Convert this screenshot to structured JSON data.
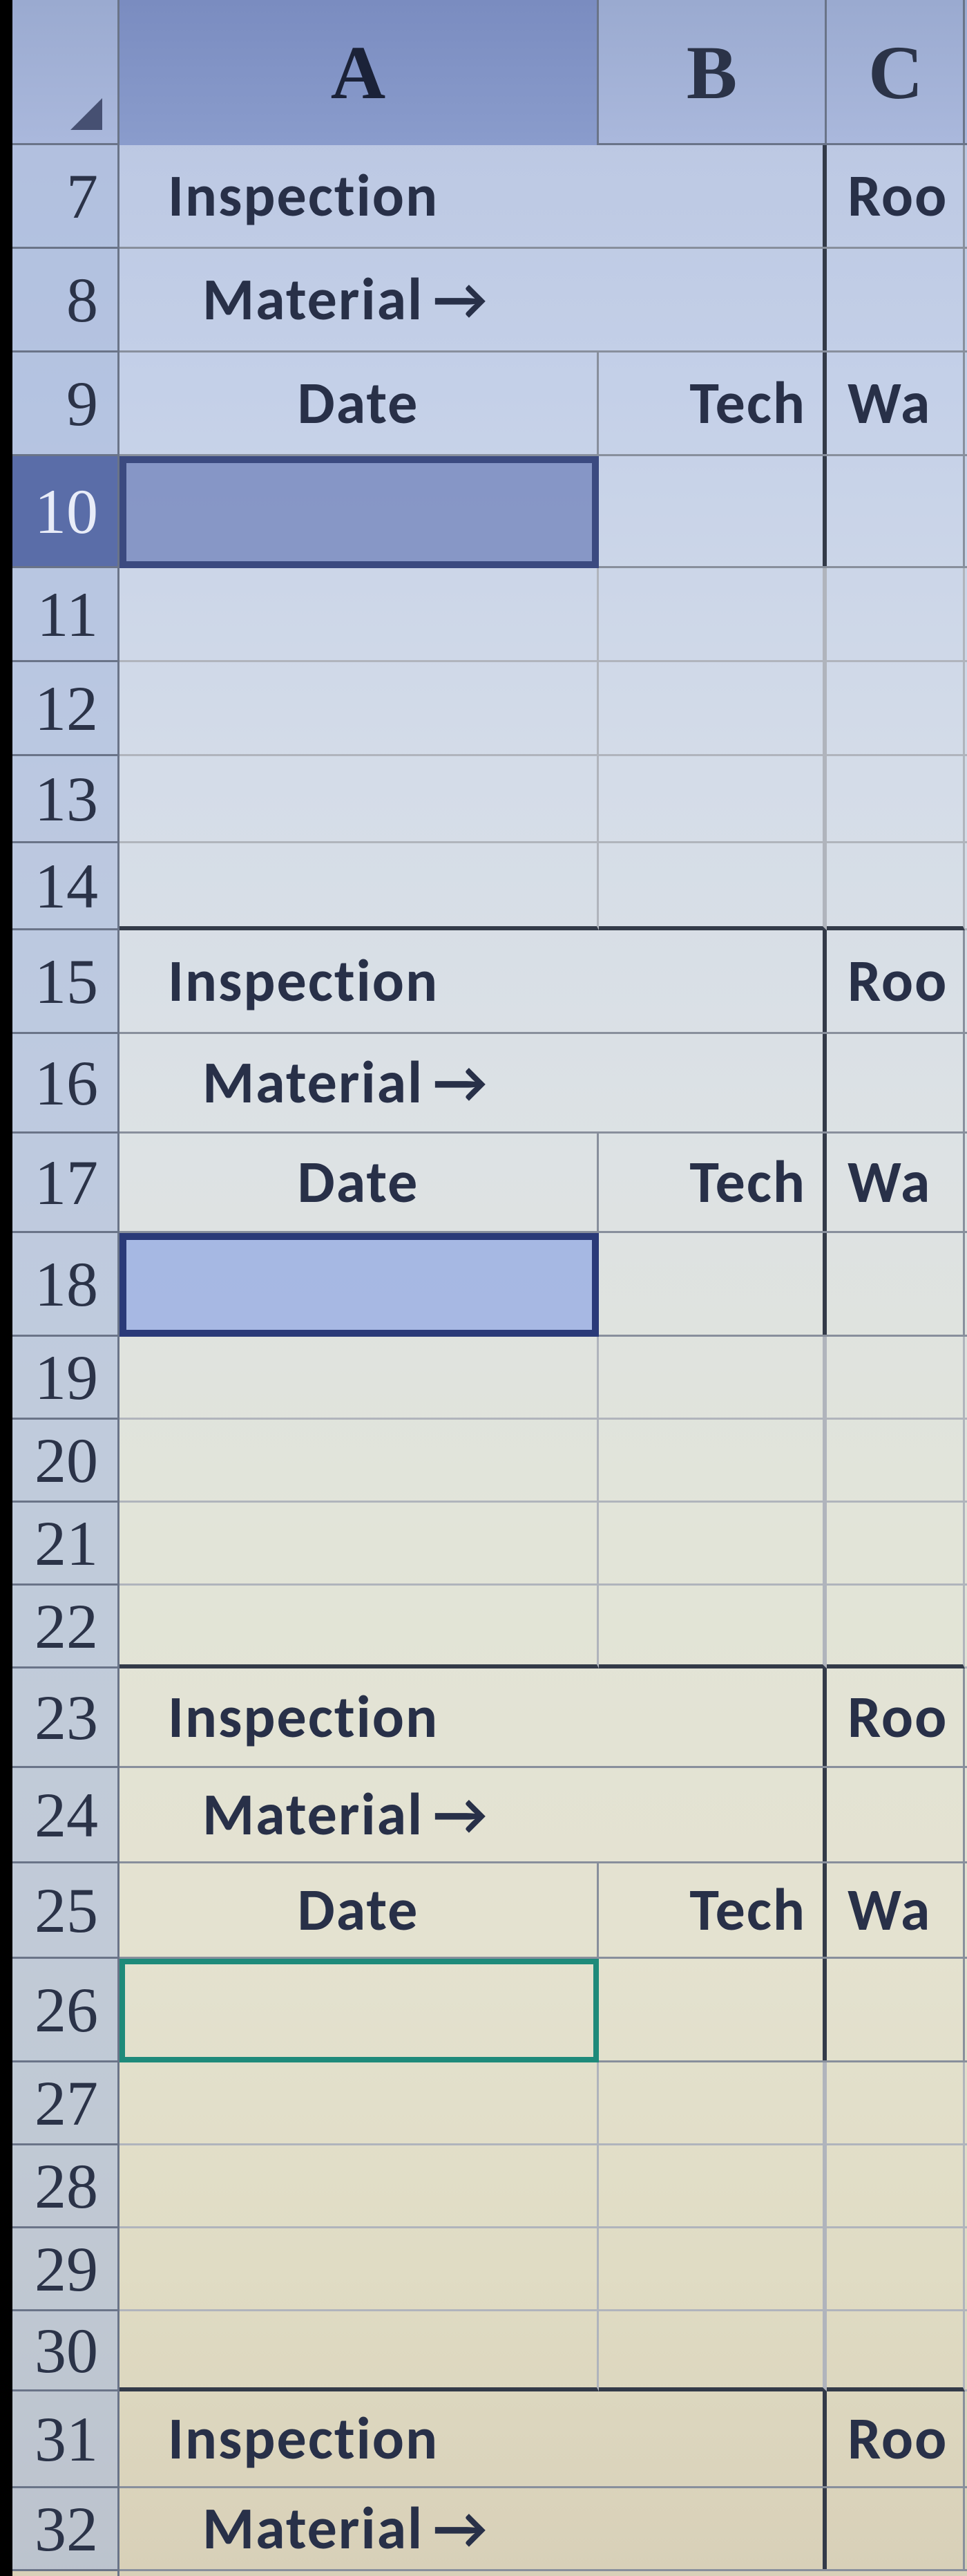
{
  "columns": {
    "a": "A",
    "b": "B",
    "c": "C"
  },
  "row_numbers": [
    "7",
    "8",
    "9",
    "10",
    "11",
    "12",
    "13",
    "14",
    "15",
    "16",
    "17",
    "18",
    "19",
    "20",
    "21",
    "22",
    "23",
    "24",
    "25",
    "26",
    "27",
    "28",
    "29",
    "30",
    "31",
    "32"
  ],
  "labels": {
    "inspection": "Inspection",
    "material": "Material",
    "date": "Date",
    "tech": "Tech",
    "room": "Roo",
    "wa": "Wa",
    "arrow": "→"
  },
  "row_heights": {
    "normal": 136,
    "data": 136,
    "data_first": 150,
    "short": 110
  },
  "selected_row": "10",
  "highlight_row": "18",
  "green_box_row": "26"
}
